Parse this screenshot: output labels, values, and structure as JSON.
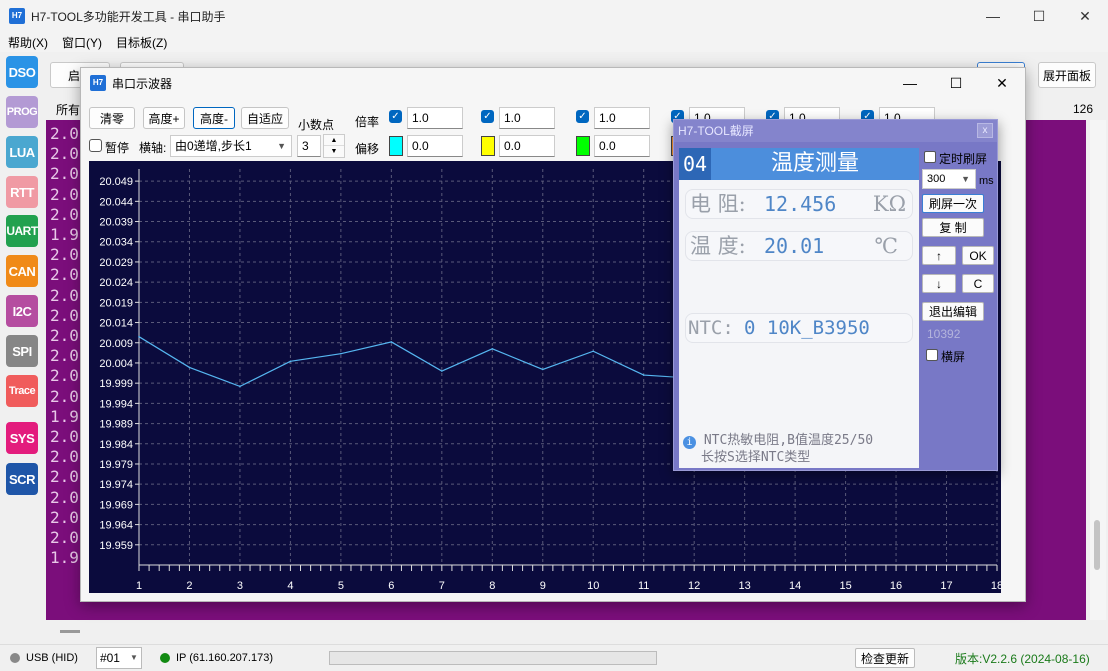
{
  "app": {
    "title": "H7-TOOL多功能开发工具 - 串口助手",
    "logo": "H7",
    "menu": [
      "帮助(X)",
      "窗口(Y)",
      "目标板(Z)"
    ]
  },
  "sidebar": [
    {
      "label": "DSO",
      "color": "#2a93e6"
    },
    {
      "label": "PROG",
      "color": "#b39ad4"
    },
    {
      "label": "LUA",
      "color": "#4aa7d0"
    },
    {
      "label": "RTT",
      "color": "#f09aa4"
    },
    {
      "label": "UART",
      "color": "#22a14f"
    },
    {
      "label": "CAN",
      "color": "#f08a18"
    },
    {
      "label": "I2C",
      "color": "#b54da0"
    },
    {
      "label": "SPI",
      "color": "#868686"
    },
    {
      "label": "Trace",
      "color": "#f05c5c"
    },
    {
      "label": "SYS",
      "color": "#e31c7d"
    },
    {
      "label": "SCR",
      "color": "#1f56a8"
    }
  ],
  "background": {
    "start_btn": "启动",
    "all_tab": "所有",
    "expand_btn": "展开面板",
    "counter": "126",
    "digits": [
      "2.0",
      "2.0",
      "2.0",
      "2.0",
      "2.0",
      "1.9",
      "2.0",
      "2.0",
      "2.0",
      "2.0",
      "2.0",
      "2.0",
      "2.0",
      "2.0",
      "1.9",
      "2.0",
      "2.0",
      "2.0",
      "2.0",
      "2.0",
      "2.0",
      "1.9"
    ]
  },
  "osc": {
    "title": "串口示波器",
    "clear_btn": "清零",
    "height_plus": "高度+",
    "height_minus": "高度-",
    "auto_btn": "自适应",
    "pause_label": "暂停",
    "xaxis_label": "横轴:",
    "xaxis_value": "由0递增,步长1",
    "decimal_label": "小数点",
    "decimal_value": "3",
    "scale_label": "倍率",
    "offset_label": "偏移",
    "channels": [
      {
        "scale": "1.0",
        "offset": "0.0",
        "color": "#00ffff"
      },
      {
        "scale": "1.0",
        "offset": "0.0",
        "color": "#ffff00"
      },
      {
        "scale": "1.0",
        "offset": "0.0",
        "color": "#00ff00"
      },
      {
        "scale": "1.0",
        "color": "#ff9933"
      },
      {
        "scale": "1.0"
      },
      {
        "scale": "1.0"
      }
    ]
  },
  "chart_data": {
    "type": "line",
    "x": [
      1,
      2,
      3,
      4,
      5,
      6,
      7,
      8,
      9,
      10,
      11,
      12,
      13,
      14,
      15,
      16,
      17,
      18
    ],
    "series": [
      {
        "color": "#56b6f0",
        "values": [
          20.0105,
          20.0029,
          19.9982,
          20.0044,
          20.0063,
          20.0092,
          20.002,
          20.0075,
          20.0024,
          20.0069,
          20.001,
          20.0002,
          20.0044,
          20.0064,
          20.004,
          20.0078,
          20.0032,
          20.006
        ]
      }
    ],
    "xticks": [
      "1",
      "2",
      "3",
      "4",
      "5",
      "6",
      "7",
      "8",
      "9",
      "10",
      "11",
      "12",
      "13",
      "14",
      "15",
      "16",
      "17",
      "18"
    ],
    "yticks": [
      "20.049",
      "20.044",
      "20.039",
      "20.034",
      "20.029",
      "20.024",
      "20.019",
      "20.014",
      "20.009",
      "20.004",
      "19.999",
      "19.994",
      "19.989",
      "19.984",
      "19.979",
      "19.974",
      "19.969",
      "19.964",
      "19.959"
    ],
    "xlim": [
      1,
      18
    ],
    "ylim": [
      19.954,
      20.052
    ],
    "grid": true
  },
  "popup": {
    "title": "H7-TOOL截屏",
    "close": "x",
    "lcd_num": "04",
    "lcd_title": "温度测量",
    "res_label": "电 阻:",
    "res_value": "12.456",
    "res_unit": "KΩ",
    "temp_label": "温 度:",
    "temp_value": "20.01",
    "temp_unit": "℃",
    "ntc_label": "NTC:",
    "ntc_value": "0 10K_B3950",
    "note1": "NTC热敏电阻,B值温度25/50",
    "note2": "长按S选择NTC类型",
    "timed_refresh": "定时刷屏",
    "interval": "300",
    "ms": "ms",
    "refresh_once": "刷屏一次",
    "copy": "复 制",
    "up": "↑",
    "ok": "OK",
    "down": "↓",
    "c": "C",
    "exit_edit": "退出编辑",
    "count": "10392",
    "landscape": "横屏"
  },
  "status": {
    "usb": "USB (HID)",
    "port": "#01",
    "ip": "IP (61.160.207.173)",
    "check_update": "检查更新",
    "version": "版本:V2.2.6 (2024-08-16)"
  }
}
